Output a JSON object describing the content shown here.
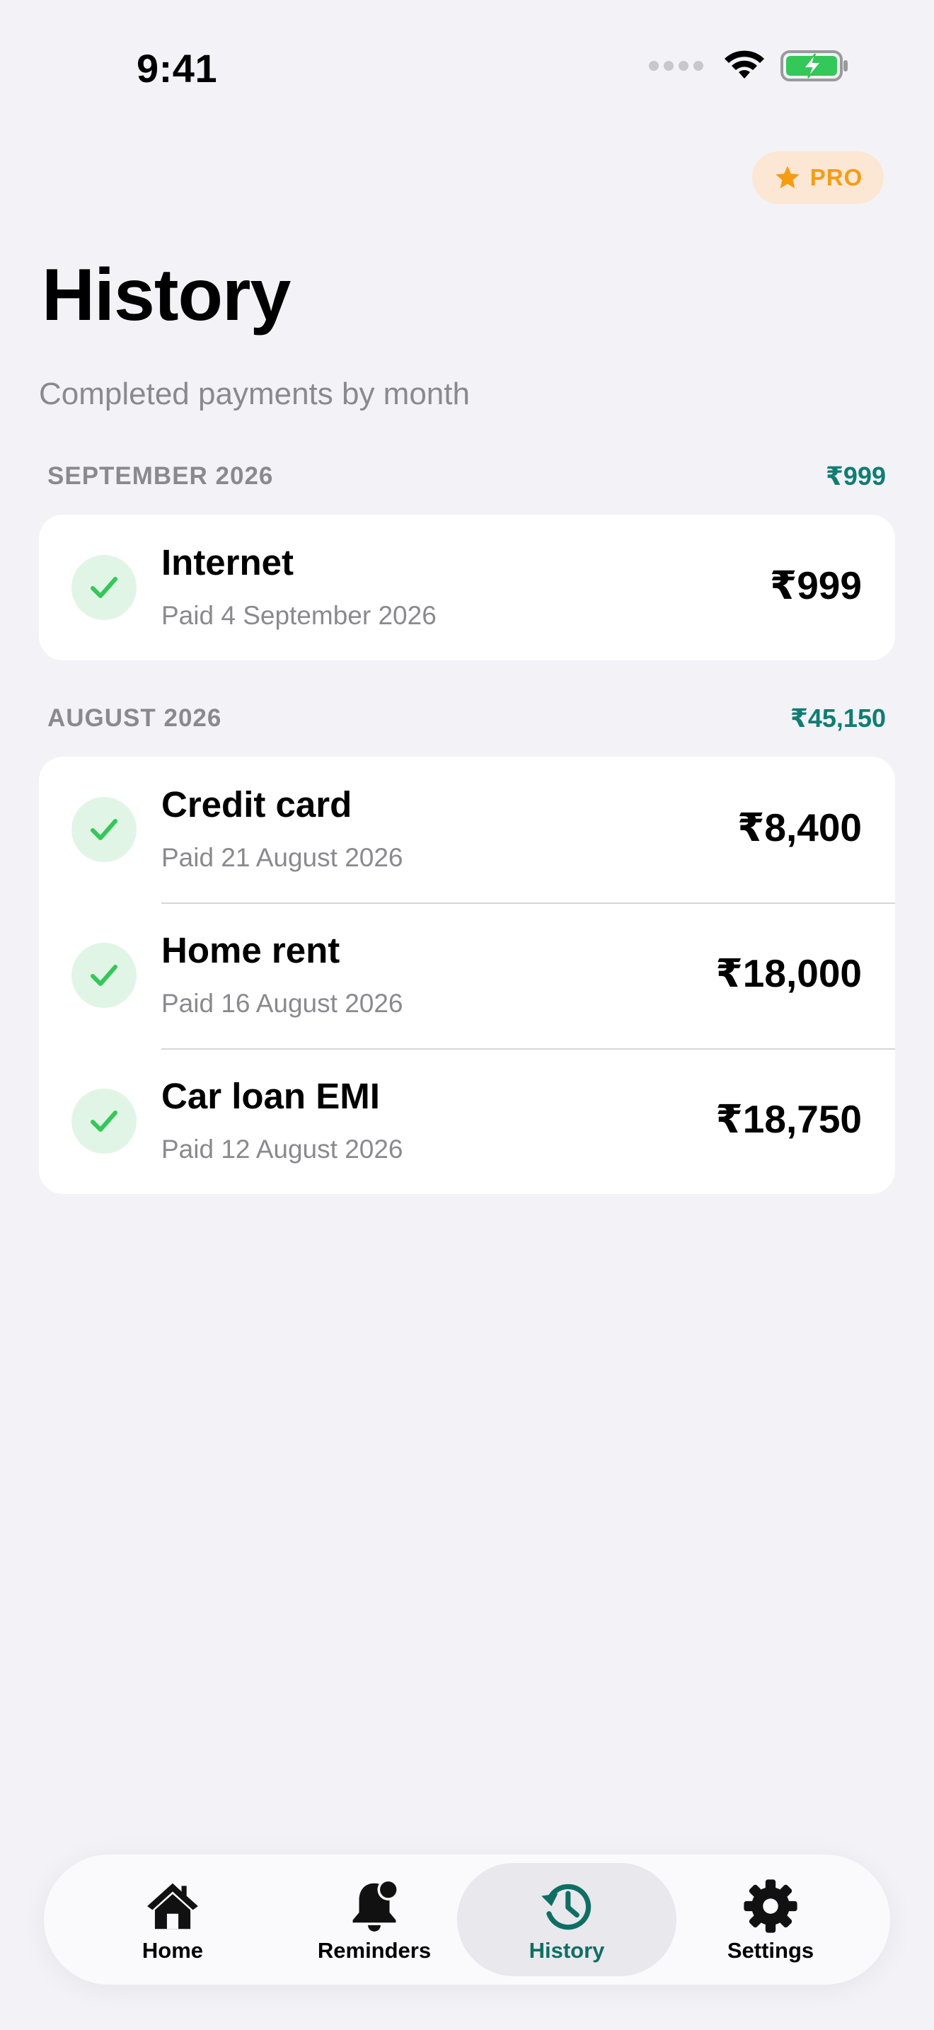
{
  "status_bar": {
    "time": "9:41"
  },
  "pro_badge": {
    "label": "PRO",
    "icon": "star-icon",
    "color": "#f59c17"
  },
  "header": {
    "title": "History",
    "subtitle": "Completed payments by month"
  },
  "sections": [
    {
      "label": "SEPTEMBER 2026",
      "total": "₹999",
      "items": [
        {
          "title": "Internet",
          "subtitle": "Paid 4 September 2026",
          "amount": "₹999",
          "icon": "check-icon"
        }
      ]
    },
    {
      "label": "AUGUST 2026",
      "total": "₹45,150",
      "items": [
        {
          "title": "Credit card",
          "subtitle": "Paid 21 August 2026",
          "amount": "₹8,400",
          "icon": "check-icon"
        },
        {
          "title": "Home rent",
          "subtitle": "Paid 16 August 2026",
          "amount": "₹18,000",
          "icon": "check-icon"
        },
        {
          "title": "Car loan EMI",
          "subtitle": "Paid 12 August 2026",
          "amount": "₹18,750",
          "icon": "check-icon"
        }
      ]
    }
  ],
  "tab_bar": {
    "tabs": [
      {
        "label": "Home",
        "icon": "house-icon",
        "active": false
      },
      {
        "label": "Reminders",
        "icon": "bell-badge-icon",
        "active": false
      },
      {
        "label": "History",
        "icon": "clock-history-icon",
        "active": true
      },
      {
        "label": "Settings",
        "icon": "gear-icon",
        "active": false
      }
    ]
  },
  "colors": {
    "background": "#f2f2f7",
    "accent_teal": "#0f7d72",
    "success_green": "#34c759",
    "pro_orange": "#f59c17"
  }
}
